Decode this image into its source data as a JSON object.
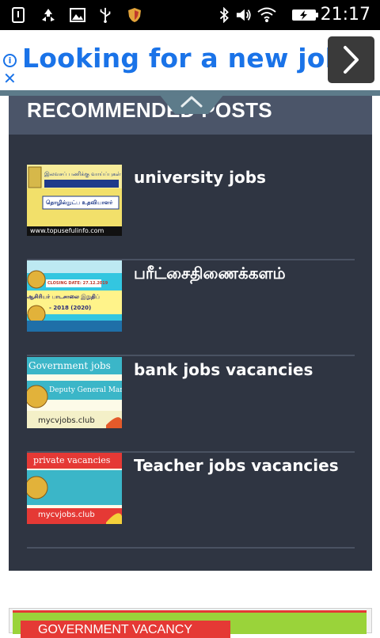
{
  "status_bar": {
    "icons": [
      "notification-icon",
      "recycle-icon",
      "image-icon",
      "usb-icon",
      "shield-app-icon"
    ],
    "right_icons": [
      "bluetooth-icon",
      "volume-icon",
      "wifi-icon",
      "battery-charging-icon"
    ],
    "time": "21:17"
  },
  "ad": {
    "headline": "Looking for a new job?",
    "info_glyph": "i",
    "close_glyph": "✕",
    "arrow_icon": "chevron-right-icon"
  },
  "recommended": {
    "title": "RECOMMENDED POSTS",
    "posts": [
      {
        "title": "university jobs",
        "thumb": {
          "top_text": "இலவசப் பணிக்கு வாய்ப்புகள்",
          "mid_text": "தொழில்நுட்ப உதவியாளர்",
          "url": "www.topusefulinfo.com"
        }
      },
      {
        "title": "பரீட்சைதிணைக்களம்",
        "thumb": {
          "closing": "CLOSING DATE: 27.12.2019",
          "line1": "ஆசிரியர் பாடசாலை இறுதிப்",
          "line2": "- 2018 (2020)"
        }
      },
      {
        "title": "bank jobs vacancies",
        "thumb": {
          "header": "Government jobs",
          "role": "Deputy General Man",
          "site": "mycvjobs.club"
        }
      },
      {
        "title": "Teacher jobs vacancies",
        "thumb": {
          "header": "private vacancies",
          "site": "mycvjobs.club"
        }
      }
    ]
  },
  "next_section": {
    "tag": "GOVERNMENT VACANCY"
  },
  "colors": {
    "ad_blue": "#1a73e8",
    "widget_header": "#4b5569",
    "widget_body": "#2f3542",
    "accent_green": "#9ad33a",
    "accent_red": "#e53935"
  }
}
